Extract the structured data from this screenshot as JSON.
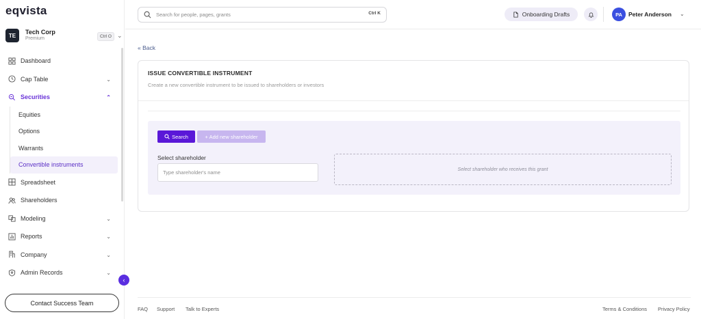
{
  "app": {
    "logo": "eqvista"
  },
  "org": {
    "initials": "TE",
    "name": "Tech Corp",
    "plan": "Premium",
    "shortcut": "Ctrl O"
  },
  "sidebar": {
    "items": [
      {
        "label": "Dashboard",
        "icon": "dashboard-icon"
      },
      {
        "label": "Cap Table",
        "icon": "clock-icon",
        "expandable": true
      },
      {
        "label": "Securities",
        "icon": "securities-icon",
        "expandable": true,
        "expanded": true,
        "active": true
      },
      {
        "label": "Spreadsheet",
        "icon": "grid-icon"
      },
      {
        "label": "Shareholders",
        "icon": "users-icon"
      },
      {
        "label": "Modeling",
        "icon": "modeling-icon",
        "expandable": true
      },
      {
        "label": "Reports",
        "icon": "reports-icon",
        "expandable": true
      },
      {
        "label": "Company",
        "icon": "company-icon",
        "expandable": true
      },
      {
        "label": "Admin Records",
        "icon": "shield-icon",
        "expandable": true
      }
    ],
    "securities_sub": [
      "Equities",
      "Options",
      "Warrants",
      "Convertible instruments"
    ],
    "active_sub": "Convertible instruments",
    "contact_button": "Contact Success Team"
  },
  "topbar": {
    "search_placeholder": "Search for people, pages, grants",
    "search_shortcut": "Ctrl K",
    "drafts_label": "Onboarding Drafts",
    "user_initials": "PA",
    "user_name": "Peter Anderson"
  },
  "main": {
    "back_label": "« Back",
    "title": "ISSUE CONVERTIBLE INSTRUMENT",
    "subtitle": "Create a new convertible instrument to be issued to shareholders or investors",
    "search_button": "Search",
    "add_button": "+ Add new shareholder",
    "select_label": "Select shareholder",
    "select_placeholder": "Type shareholder's name",
    "drop_zone_text": "Select shareholder who receives this grant"
  },
  "footer": {
    "links_left": [
      "FAQ",
      "Support",
      "Talk to Experts"
    ],
    "links_right": [
      "Terms & Conditions",
      "Privacy Policy"
    ]
  },
  "colors": {
    "accent": "#5a18d8",
    "accent_light": "#c7b6ef",
    "panel_bg": "#f3f1fb",
    "active_nav": "#6a34d8"
  }
}
